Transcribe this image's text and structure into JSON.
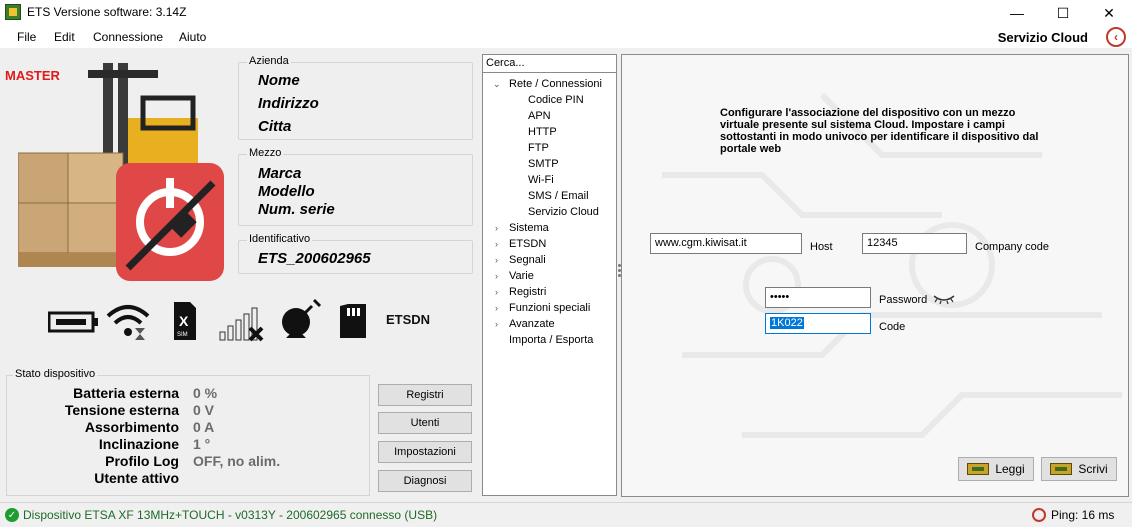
{
  "window": {
    "title": "ETS Versione software:  3.14Z",
    "controls": {
      "minimize": "—",
      "maximize": "☐",
      "close": "✕"
    }
  },
  "menu": {
    "items": [
      "File",
      "Edit",
      "Connessione",
      "Aiuto"
    ],
    "page_title": "Servizio Cloud",
    "back_icon": "‹"
  },
  "left": {
    "role_badge": "MASTER",
    "azienda": {
      "label": "Azienda",
      "nome": "Nome",
      "indirizzo": "Indirizzo",
      "citta": "Citta"
    },
    "mezzo": {
      "label": "Mezzo",
      "marca": "Marca",
      "modello": "Modello",
      "num_serie": "Num. serie"
    },
    "identificativo": {
      "label": "Identificativo",
      "value": "ETS_200602965"
    },
    "icons": [
      "battery-icon",
      "wifi-hourglass-icon",
      "sim-missing-icon",
      "signal-off-icon",
      "satellite-icon",
      "sd-card-icon",
      "etsdn-icon"
    ],
    "etsdn_text": "ETSDN",
    "stato": {
      "label": "Stato dispositivo",
      "rows": [
        {
          "key": "Batteria esterna",
          "value": "0 %"
        },
        {
          "key": "Tensione esterna",
          "value": "0 V"
        },
        {
          "key": "Assorbimento",
          "value": "0 A"
        },
        {
          "key": "Inclinazione",
          "value": "1 °"
        },
        {
          "key": "Profilo Log",
          "value": "OFF, no alim."
        },
        {
          "key": "Utente attivo",
          "value": ""
        }
      ]
    },
    "buttons": {
      "registri": "Registri",
      "utenti": "Utenti",
      "impostazioni": "Impostazioni",
      "diagnosi": "Diagnosi"
    }
  },
  "tree": {
    "search_placeholder": "Cerca...",
    "root_expanded": {
      "label": "Rete / Connessioni",
      "arrow": "⌄"
    },
    "children": [
      "Codice PIN",
      "APN",
      "HTTP",
      "FTP",
      "SMTP",
      "Wi-Fi",
      "SMS / Email",
      "Servizio Cloud"
    ],
    "collapsed": [
      "Sistema",
      "ETSDN",
      "Segnali",
      "Varie",
      "Registri",
      "Funzioni speciali",
      "Avanzate"
    ],
    "collapsed_arrow": "›",
    "leaf": "Importa / Esporta"
  },
  "cloud": {
    "description": "Configurare l'associazione del dispositivo con un mezzo virtuale presente sul sistema Cloud. Impostare i campi sottostanti in modo univoco per identificare il dispositivo dal portale web",
    "host_value": "www.cgm.kiwisat.it",
    "host_label": "Host",
    "company_value": "12345",
    "company_label": "Company code",
    "password_value": "•••••",
    "password_label": "Password",
    "eye_icon": "eye-closed-icon",
    "code_value": "1K022",
    "code_label": "Code",
    "leggi_label": "Leggi",
    "scrivi_label": "Scrivi"
  },
  "status_bar": {
    "check_icon": "✓",
    "text": "Dispositivo ETSA XF 13MHz+TOUCH - v0313Y - 200602965 connesso (USB)",
    "ping": "Ping: 16 ms"
  },
  "colors": {
    "accent_red": "#e01b1b",
    "status_green": "#1d6b26",
    "selection": "#0078d7"
  }
}
